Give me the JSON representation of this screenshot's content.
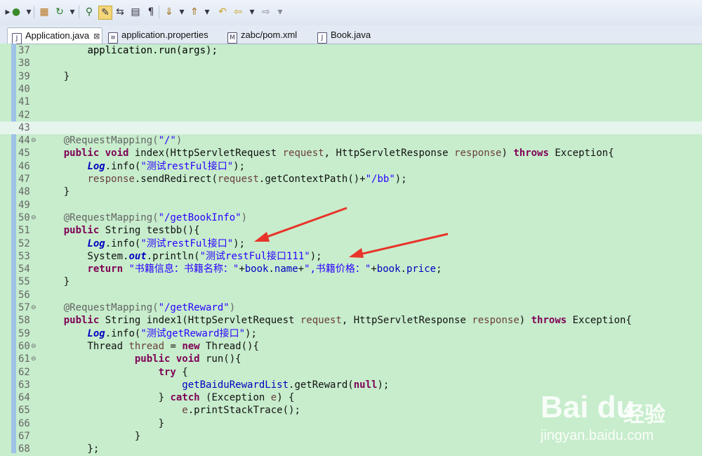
{
  "tabs": [
    {
      "label": "Application.java",
      "icon": "java-file-icon",
      "active": true,
      "close": "⊠"
    },
    {
      "label": "application.properties",
      "icon": "properties-file-icon",
      "active": false
    },
    {
      "label": "zabc/pom.xml",
      "icon": "maven-pom-icon",
      "active": false
    },
    {
      "label": "Book.java",
      "icon": "java-file-icon",
      "active": false
    }
  ],
  "lines": [
    {
      "n": "37",
      "segs": [
        [
          "",
          "        "
        ],
        [
          "mth",
          "application.run(args);"
        ]
      ]
    },
    {
      "n": "38",
      "segs": []
    },
    {
      "n": "39",
      "segs": [
        [
          "",
          "    }"
        ]
      ]
    },
    {
      "n": "40",
      "segs": []
    },
    {
      "n": "41",
      "segs": []
    },
    {
      "n": "42",
      "segs": []
    },
    {
      "n": "43",
      "segs": [],
      "hl": true
    },
    {
      "n": "44",
      "fold": "⊖",
      "segs": [
        [
          "",
          "    "
        ],
        [
          "ann",
          "@RequestMapping("
        ],
        [
          "str",
          "\"/\""
        ],
        [
          "ann",
          ")"
        ]
      ]
    },
    {
      "n": "45",
      "segs": [
        [
          "",
          "    "
        ],
        [
          "kw",
          "public void"
        ],
        [
          "",
          " index(HttpServletRequest "
        ],
        [
          "var",
          "request"
        ],
        [
          "",
          ", HttpServletResponse "
        ],
        [
          "var",
          "response"
        ],
        [
          "",
          ") "
        ],
        [
          "kw",
          "throws"
        ],
        [
          "",
          " Exception{"
        ]
      ]
    },
    {
      "n": "46",
      "segs": [
        [
          "",
          "        "
        ],
        [
          "ital",
          "Log"
        ],
        [
          "",
          ".info("
        ],
        [
          "str",
          "\"测试restFul接口\""
        ],
        [
          "",
          ");"
        ]
      ]
    },
    {
      "n": "47",
      "segs": [
        [
          "",
          "        "
        ],
        [
          "var",
          "response"
        ],
        [
          "",
          ".sendRedirect("
        ],
        [
          "var",
          "request"
        ],
        [
          "",
          ".getContextPath()+"
        ],
        [
          "str",
          "\"/bb\""
        ],
        [
          "",
          ");"
        ]
      ]
    },
    {
      "n": "48",
      "segs": [
        [
          "",
          "    }"
        ]
      ]
    },
    {
      "n": "49",
      "segs": []
    },
    {
      "n": "50",
      "fold": "⊖",
      "segs": [
        [
          "",
          "    "
        ],
        [
          "ann",
          "@RequestMapping("
        ],
        [
          "str",
          "\"/getBookInfo\""
        ],
        [
          "ann",
          ")"
        ]
      ]
    },
    {
      "n": "51",
      "segs": [
        [
          "",
          "    "
        ],
        [
          "kw",
          "public"
        ],
        [
          "",
          " String testbb(){"
        ]
      ]
    },
    {
      "n": "52",
      "segs": [
        [
          "",
          "        "
        ],
        [
          "ital",
          "Log"
        ],
        [
          "",
          ".info("
        ],
        [
          "str",
          "\"测试restFul接口\""
        ],
        [
          "",
          ");"
        ]
      ]
    },
    {
      "n": "53",
      "segs": [
        [
          "",
          "        System."
        ],
        [
          "ital",
          "out"
        ],
        [
          "",
          ".println("
        ],
        [
          "str",
          "\"测试restFul接口111\""
        ],
        [
          "",
          ");"
        ]
      ]
    },
    {
      "n": "54",
      "segs": [
        [
          "",
          "        "
        ],
        [
          "kw",
          "return"
        ],
        [
          "",
          " "
        ],
        [
          "str",
          "\"书籍信息：书籍名称：\""
        ],
        [
          "",
          "+"
        ],
        [
          "fld",
          "book"
        ],
        [
          "",
          "."
        ],
        [
          "fld",
          "name"
        ],
        [
          "",
          "+"
        ],
        [
          "str",
          "\",书籍价格：\""
        ],
        [
          "",
          "+"
        ],
        [
          "fld",
          "book"
        ],
        [
          "",
          "."
        ],
        [
          "fld",
          "price"
        ],
        [
          "",
          ";"
        ]
      ]
    },
    {
      "n": "55",
      "segs": [
        [
          "",
          "    }"
        ]
      ]
    },
    {
      "n": "56",
      "segs": []
    },
    {
      "n": "57",
      "fold": "⊖",
      "segs": [
        [
          "",
          "    "
        ],
        [
          "ann",
          "@RequestMapping("
        ],
        [
          "str",
          "\"/getReward\""
        ],
        [
          "ann",
          ")"
        ]
      ]
    },
    {
      "n": "58",
      "segs": [
        [
          "",
          "    "
        ],
        [
          "kw",
          "public"
        ],
        [
          "",
          " String index1(HttpServletRequest "
        ],
        [
          "var",
          "request"
        ],
        [
          "",
          ", HttpServletResponse "
        ],
        [
          "var",
          "response"
        ],
        [
          "",
          ") "
        ],
        [
          "kw",
          "throws"
        ],
        [
          "",
          " Exception{"
        ]
      ]
    },
    {
      "n": "59",
      "segs": [
        [
          "",
          "        "
        ],
        [
          "ital",
          "Log"
        ],
        [
          "",
          ".info("
        ],
        [
          "str",
          "\"测试getReward接口\""
        ],
        [
          "",
          ");"
        ]
      ]
    },
    {
      "n": "60",
      "fold": "⊖",
      "segs": [
        [
          "",
          "        Thread "
        ],
        [
          "var",
          "thread"
        ],
        [
          "",
          " = "
        ],
        [
          "kw",
          "new"
        ],
        [
          "",
          " Thread(){"
        ]
      ]
    },
    {
      "n": "61",
      "fold": "⊖",
      "segs": [
        [
          "",
          "                "
        ],
        [
          "kw",
          "public void"
        ],
        [
          "",
          " run(){"
        ]
      ]
    },
    {
      "n": "62",
      "segs": [
        [
          "",
          "                    "
        ],
        [
          "kw",
          "try"
        ],
        [
          "",
          " {"
        ]
      ]
    },
    {
      "n": "63",
      "segs": [
        [
          "",
          "                        "
        ],
        [
          "fld",
          "getBaiduRewardList"
        ],
        [
          "",
          ".getReward("
        ],
        [
          "kw",
          "null"
        ],
        [
          "",
          ");"
        ]
      ]
    },
    {
      "n": "64",
      "segs": [
        [
          "",
          "                    } "
        ],
        [
          "kw",
          "catch"
        ],
        [
          "",
          " (Exception "
        ],
        [
          "var",
          "e"
        ],
        [
          "",
          ") {"
        ]
      ]
    },
    {
      "n": "65",
      "segs": [
        [
          "",
          "                        "
        ],
        [
          "var",
          "e"
        ],
        [
          "",
          ".printStackTrace();"
        ]
      ]
    },
    {
      "n": "66",
      "segs": [
        [
          "",
          "                    }"
        ]
      ]
    },
    {
      "n": "67",
      "segs": [
        [
          "",
          "                }"
        ]
      ]
    },
    {
      "n": "68",
      "segs": [
        [
          "",
          "        };"
        ]
      ]
    }
  ],
  "watermark": {
    "brand": "Bai du",
    "brand_cn": "经验",
    "url": "jingyan.baidu.com"
  },
  "colors": {
    "accent_arrow": "#e8342a",
    "editor_bg": "#c7edcc",
    "gutter_stripe": "#9fc3e6"
  }
}
